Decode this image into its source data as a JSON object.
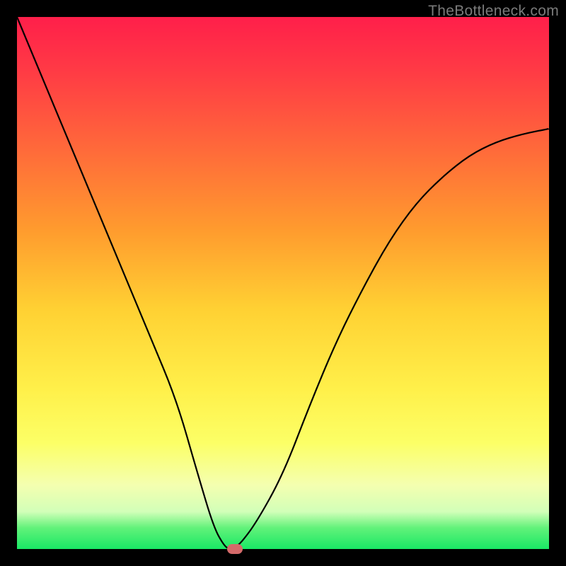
{
  "watermark": "TheBottleneck.com",
  "chart_data": {
    "type": "line",
    "title": "",
    "xlabel": "",
    "ylabel": "",
    "xlim": [
      0,
      100
    ],
    "ylim": [
      0,
      100
    ],
    "series": [
      {
        "name": "bottleneck-curve",
        "x": [
          0,
          5,
          10,
          15,
          20,
          25,
          30,
          34,
          37,
          39,
          40,
          41,
          42,
          45,
          50,
          55,
          60,
          65,
          70,
          75,
          80,
          85,
          90,
          95,
          100
        ],
        "values": [
          100,
          88,
          76,
          64,
          52,
          40,
          28,
          14,
          4,
          0.5,
          0,
          0.5,
          1,
          5,
          14,
          27,
          39,
          49,
          58,
          65,
          70,
          74,
          76.5,
          78,
          79
        ]
      }
    ],
    "marker": {
      "x": 41,
      "y": 0
    },
    "gradient_note": "background encodes bottleneck severity from red (top, high) to green (bottom, low)"
  }
}
